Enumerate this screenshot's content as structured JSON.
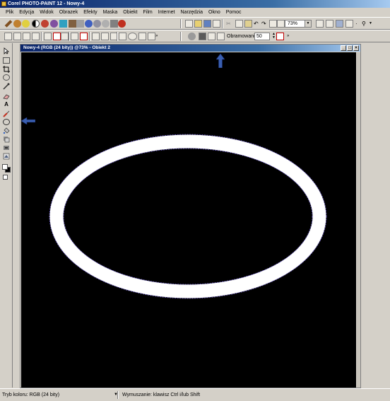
{
  "app": {
    "title": "Corel PHOTO-PAINT 12 - Nowy-4"
  },
  "menu": {
    "items": [
      "Plik",
      "Edycja",
      "Widok",
      "Obrazek",
      "Efekty",
      "Maska",
      "Obiekt",
      "Film",
      "Internet",
      "Narzędzia",
      "Okno",
      "Pomoc"
    ]
  },
  "toolbar": {
    "zoom_value": "73%",
    "obramowanie_label": "Obramowanie",
    "obramowanie_value": "50"
  },
  "document": {
    "title": "Nowy-4 (RGB (24 bity)) @73% - Obiekt 2",
    "canvas_color": "#000000",
    "ring_color": "#ffffff",
    "selection_color": "#6a5acd"
  },
  "icons": {
    "arrow_color": "#3a5fb0"
  },
  "status": {
    "color_mode": "Tryb koloru: RGB (24 bity)",
    "hint": "Wymuszanie: klawisz Ctrl i/lub Shift"
  }
}
